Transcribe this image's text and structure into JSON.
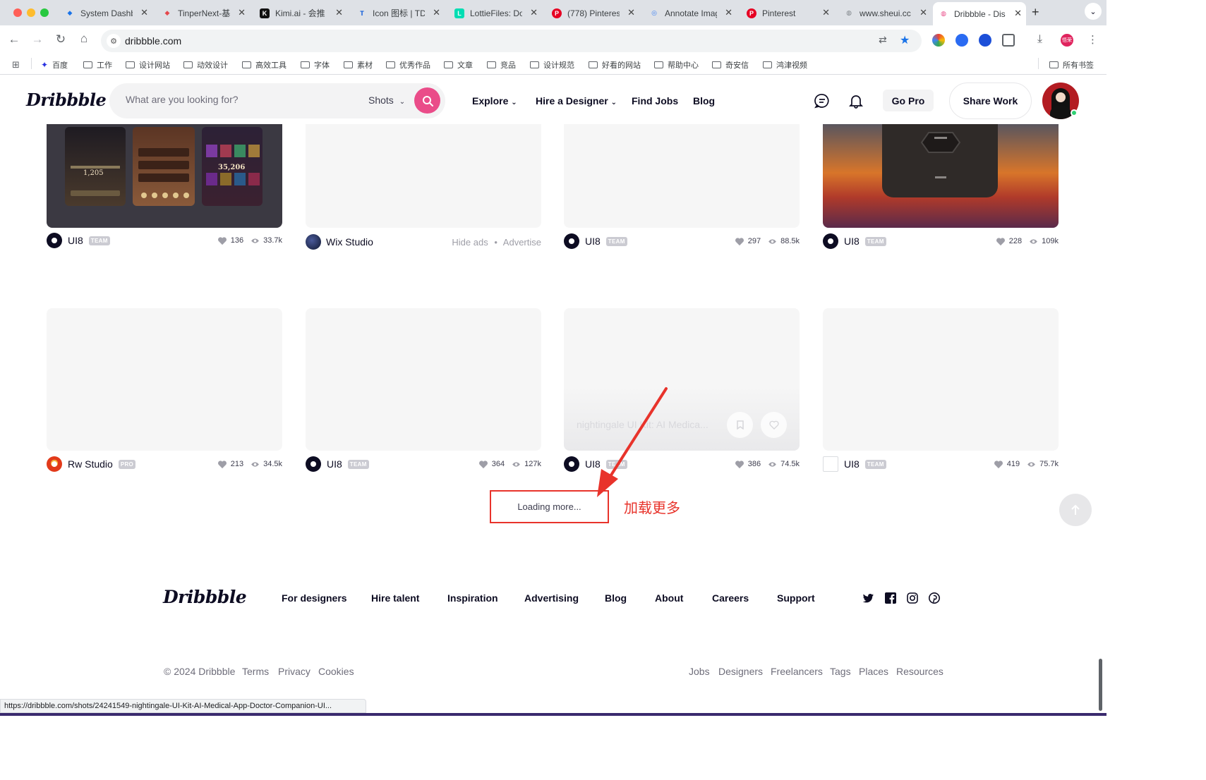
{
  "browser": {
    "tabs": [
      {
        "title": "System Dashb",
        "color": "#1a73e8",
        "glyph": "◆"
      },
      {
        "title": "TinperNext-基",
        "color": "#e5484d",
        "glyph": "◆"
      },
      {
        "title": "Kimi.ai - 会推",
        "color": "#111111",
        "glyph": "K"
      },
      {
        "title": "Icon 图标 | TD",
        "color": "#0052d9",
        "glyph": "T"
      },
      {
        "title": "LottieFiles: Do",
        "color": "#00ddb3",
        "glyph": "L"
      },
      {
        "title": "(778) Pinteres",
        "color": "#e60023",
        "glyph": "P"
      },
      {
        "title": "Annotate Imag",
        "color": "#4285f4",
        "glyph": "◎"
      },
      {
        "title": "Pinterest",
        "color": "#e60023",
        "glyph": "P"
      },
      {
        "title": "www.sheui.cc",
        "color": "#80868b",
        "glyph": "◍"
      },
      {
        "title": "Dribbble - Dis",
        "color": "#ea4c89",
        "glyph": "◍",
        "active": true
      }
    ],
    "url": "dribbble.com",
    "bookmarks": [
      "百度",
      "工作",
      "设计网站",
      "动效设计",
      "高效工具",
      "字体",
      "素材",
      "优秀作品",
      "文章",
      "竞品",
      "设计规范",
      "好看的网站",
      "帮助中心",
      "奇安信",
      "鸿津视频",
      "所有书签"
    ],
    "profile_label": "悟荣",
    "status_url": "https://dribbble.com/shots/24241549-nightingale-UI-Kit-AI-Medical-App-Doctor-Companion-UI..."
  },
  "header": {
    "logo": "Dribbble",
    "search_placeholder": "What are you looking for?",
    "search_type": "Shots",
    "nav": [
      "Explore",
      "Hire a Designer",
      "Find Jobs",
      "Blog"
    ],
    "go_pro": "Go Pro",
    "share_work": "Share Work"
  },
  "shots_row1": [
    {
      "author": "UI8",
      "badge": "TEAM",
      "likes": "136",
      "views": "33.7k"
    },
    {
      "author": "Wix Studio",
      "ad": true,
      "hide_ads": "Hide ads",
      "advertise": "Advertise"
    },
    {
      "author": "UI8",
      "badge": "TEAM",
      "likes": "297",
      "views": "88.5k"
    },
    {
      "author": "UI8",
      "badge": "TEAM",
      "likes": "228",
      "views": "109k"
    }
  ],
  "shots_row2": [
    {
      "author": "Rw Studio",
      "badge": "PRO",
      "likes": "213",
      "views": "34.5k"
    },
    {
      "author": "UI8",
      "badge": "TEAM",
      "likes": "364",
      "views": "127k"
    },
    {
      "author": "UI8",
      "badge": "TEAM",
      "likes": "386",
      "views": "74.5k",
      "hover_title": "nightingale UI Kit: AI Medica..."
    },
    {
      "author": "UI8",
      "badge": "TEAM",
      "likes": "419",
      "views": "75.7k"
    }
  ],
  "shot_card_text": {
    "count_1": "1,205",
    "count_2": "35,206"
  },
  "loading_label": "Loading more...",
  "annotation_label": "加载更多",
  "annotation_color": "#e8332b",
  "accent_color": "#ea4c89",
  "footer": {
    "logo": "Dribbble",
    "links": [
      "For designers",
      "Hire talent",
      "Inspiration",
      "Advertising",
      "Blog",
      "About",
      "Careers",
      "Support"
    ],
    "social": [
      "twitter-icon",
      "facebook-icon",
      "instagram-icon",
      "pinterest-icon"
    ],
    "copyright": "© 2024 Dribbble",
    "legal": [
      "Terms",
      "Privacy",
      "Cookies"
    ],
    "directory": [
      "Jobs",
      "Designers",
      "Freelancers",
      "Tags",
      "Places",
      "Resources"
    ]
  }
}
